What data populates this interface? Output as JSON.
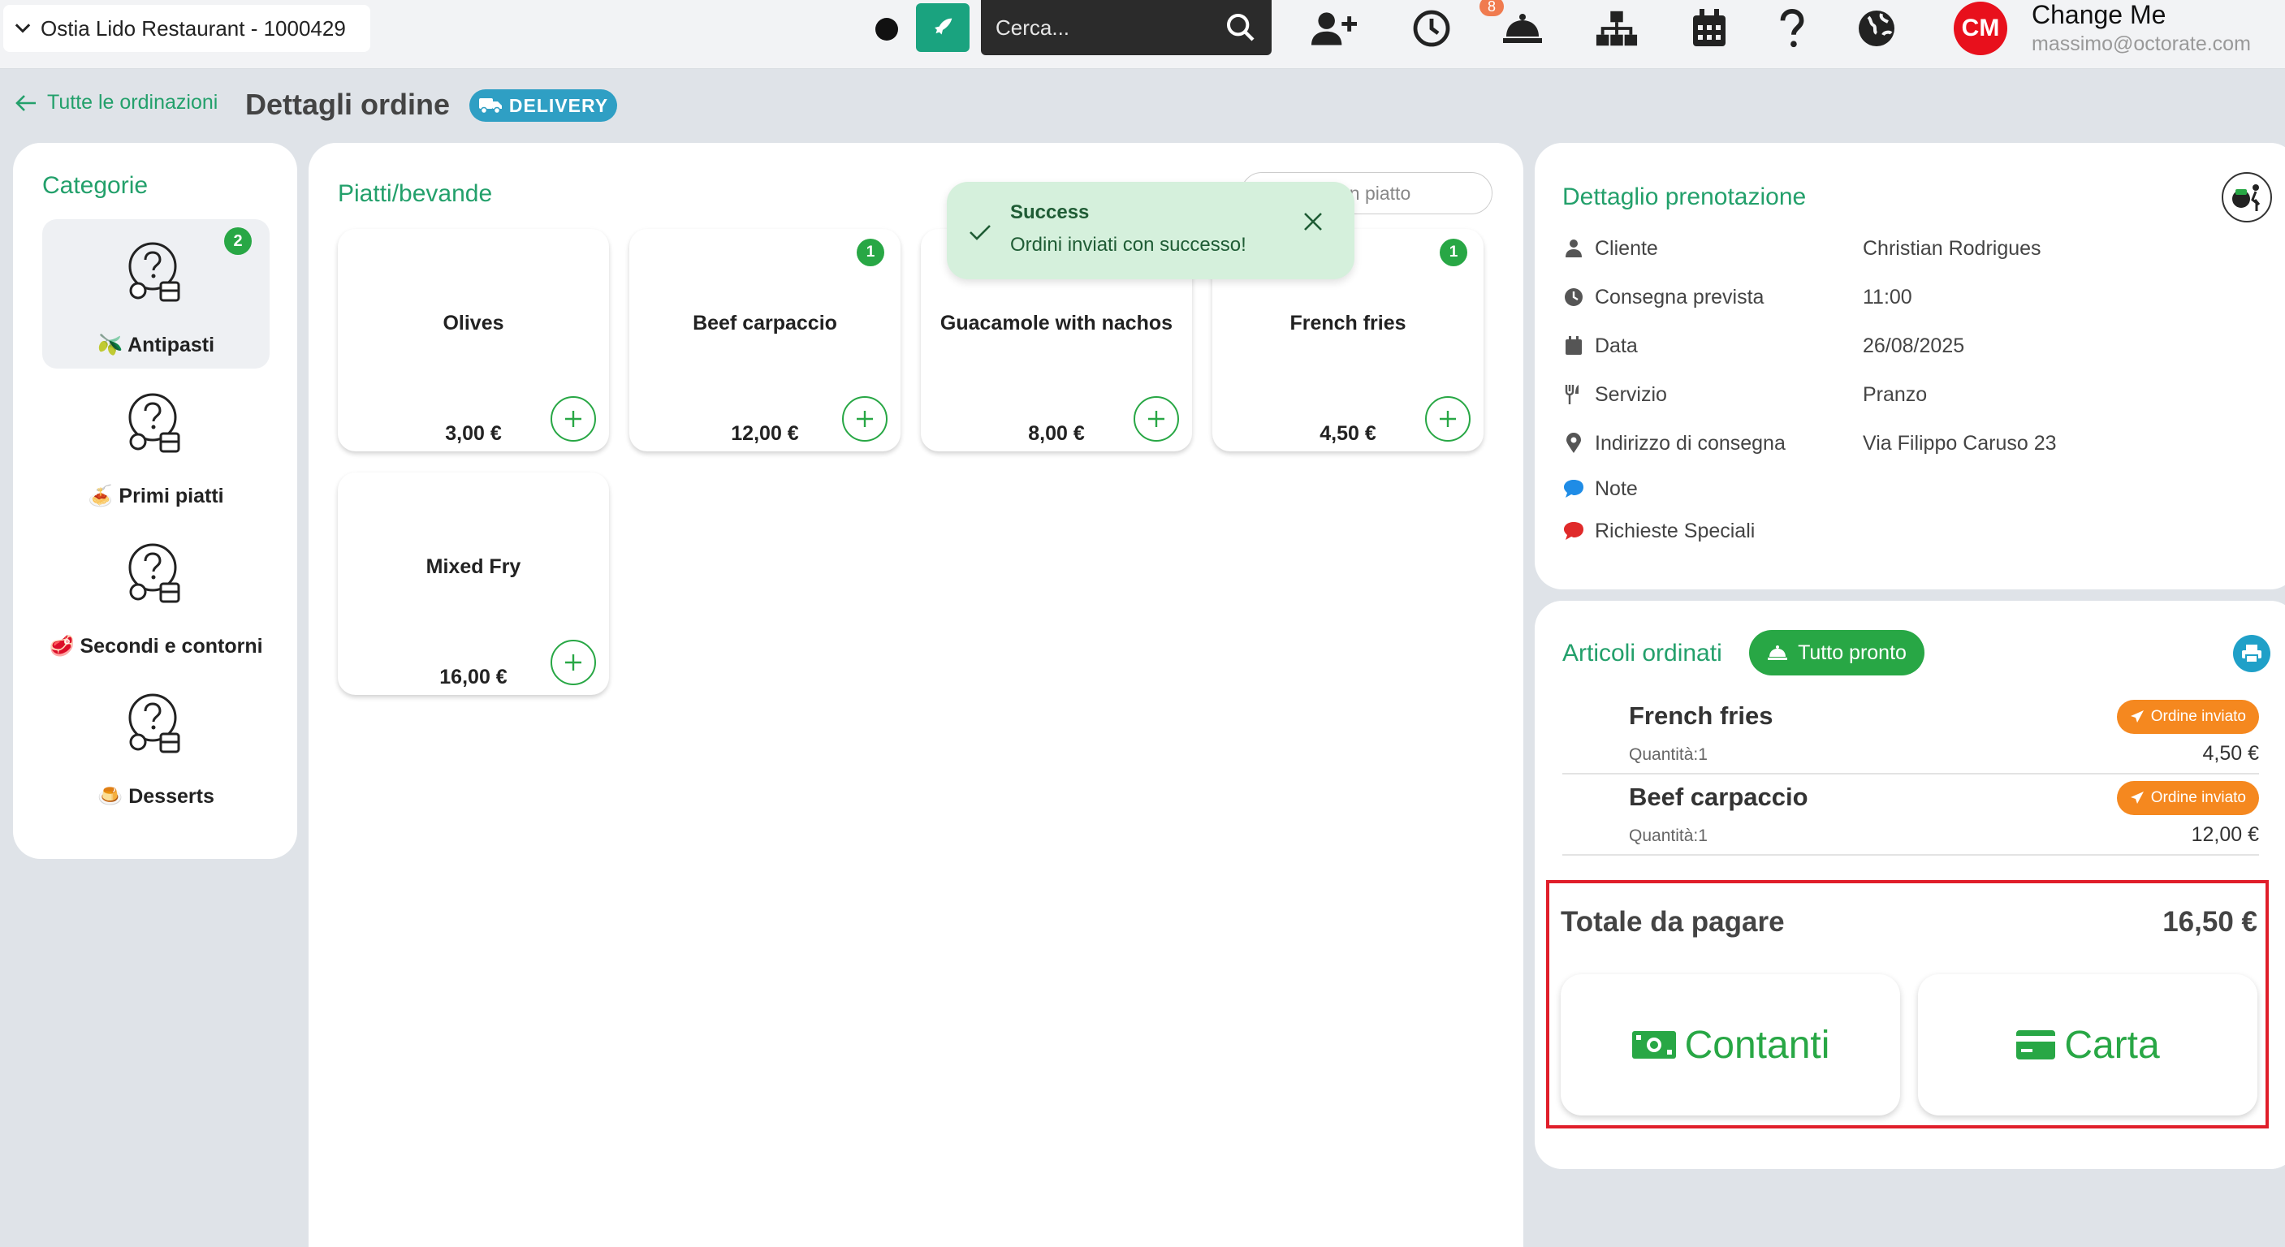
{
  "topbar": {
    "restaurant": "Ostia Lido Restaurant - 1000429",
    "search_placeholder": "Cerca...",
    "notification_count": "8",
    "user_initials": "CM",
    "user_name": "Change Me",
    "user_email": "massimo@octorate.com",
    "icons": [
      "chevron-down-icon",
      "status-dot",
      "rocket-icon",
      "search-icon",
      "add-user-icon",
      "clock-icon",
      "service-bell-icon",
      "sitemap-icon",
      "calendar-icon",
      "help-icon",
      "globe-icon"
    ]
  },
  "breadcrumb": {
    "back_label": "Tutte le ordinazioni",
    "title": "Dettagli ordine",
    "order_type": "DELIVERY"
  },
  "categories": {
    "title": "Categorie",
    "items": [
      {
        "label": "🫒 Antipasti",
        "badge": "2",
        "active": true
      },
      {
        "label": "🍝 Primi piatti",
        "badge": "",
        "active": false
      },
      {
        "label": "🥩 Secondi e contorni",
        "badge": "",
        "active": false
      },
      {
        "label": "🍮 Desserts",
        "badge": "",
        "active": false
      }
    ]
  },
  "menu": {
    "title": "Piatti/bevande",
    "search_placeholder": "un piatto",
    "dishes": [
      {
        "name": "Olives",
        "price": "3,00 €",
        "badge": ""
      },
      {
        "name": "Beef carpaccio",
        "price": "12,00 €",
        "badge": "1"
      },
      {
        "name": "Guacamole with nachos",
        "price": "8,00 €",
        "badge": ""
      },
      {
        "name": "French fries",
        "price": "4,50 €",
        "badge": "1"
      },
      {
        "name": "Mixed Fry",
        "price": "16,00 €",
        "badge": ""
      }
    ]
  },
  "toast": {
    "title": "Success",
    "message": "Ordini inviati con successo!"
  },
  "booking": {
    "title": "Dettaglio prenotazione",
    "rows": [
      {
        "icon": "user-icon",
        "label": "Cliente",
        "value": "Christian Rodrigues"
      },
      {
        "icon": "clock-icon",
        "label": "Consegna prevista",
        "value": "11:00"
      },
      {
        "icon": "calendar-icon",
        "label": "Data",
        "value": "26/08/2025"
      },
      {
        "icon": "utensils-icon",
        "label": "Servizio",
        "value": "Pranzo"
      },
      {
        "icon": "map-pin-icon",
        "label": "Indirizzo di consegna",
        "value": "Via Filippo Caruso 23"
      },
      {
        "icon": "comment-icon",
        "label": "Note",
        "value": ""
      },
      {
        "icon": "comment-icon",
        "label": "Richieste Speciali",
        "value": ""
      }
    ]
  },
  "ordered": {
    "title": "Articoli ordinati",
    "ready_label": "Tutto pronto",
    "items": [
      {
        "name": "French fries",
        "qty": "Quantità:1",
        "price": "4,50 €",
        "status": "Ordine inviato"
      },
      {
        "name": "Beef carpaccio",
        "qty": "Quantità:1",
        "price": "12,00 €",
        "status": "Ordine inviato"
      }
    ],
    "total_label": "Totale da pagare",
    "total_value": "16,50 €",
    "pay_cash": "Contanti",
    "pay_card": "Carta"
  },
  "colors": {
    "accent": "#28a745",
    "delivery": "#2f9fc4",
    "status_sent": "#f5881f",
    "highlight": "#e01e2a"
  }
}
